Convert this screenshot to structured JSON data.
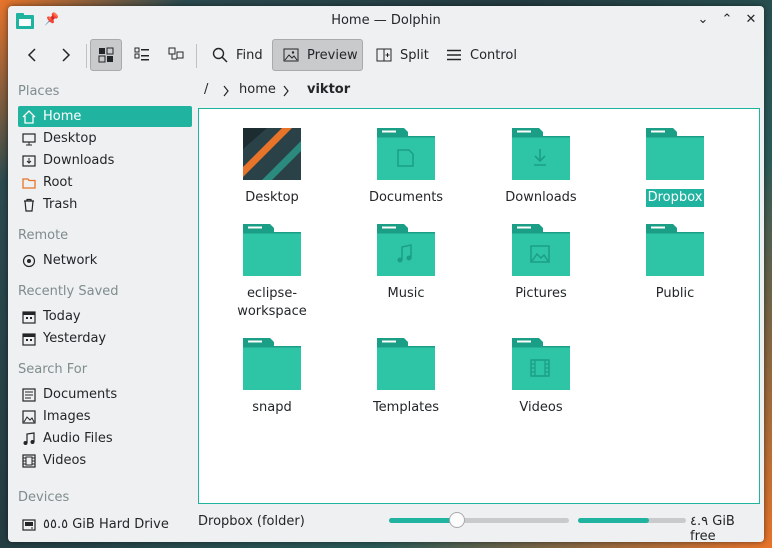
{
  "window": {
    "title": "Home — Dolphin",
    "buttons": [
      "⌄",
      "⌃",
      "✕"
    ]
  },
  "toolbar": {
    "back_icon": "chevron-left-icon",
    "forward_icon": "chevron-right-icon",
    "find_label": "Find",
    "preview_label": "Preview",
    "split_label": "Split",
    "control_label": "Control"
  },
  "sidebar": {
    "places_title": "Places",
    "places": [
      {
        "label": "Home",
        "icon": "home-icon",
        "selected": true
      },
      {
        "label": "Desktop",
        "icon": "desktop-icon"
      },
      {
        "label": "Downloads",
        "icon": "download-icon"
      },
      {
        "label": "Root",
        "icon": "folder-root-icon"
      },
      {
        "label": "Trash",
        "icon": "trash-icon"
      }
    ],
    "remote_title": "Remote",
    "remote": [
      {
        "label": "Network",
        "icon": "network-icon"
      }
    ],
    "recent_title": "Recently Saved",
    "recent": [
      {
        "label": "Today",
        "icon": "calendar-icon"
      },
      {
        "label": "Yesterday",
        "icon": "calendar-icon"
      }
    ],
    "search_title": "Search For",
    "search": [
      {
        "label": "Documents",
        "icon": "document-icon"
      },
      {
        "label": "Images",
        "icon": "image-icon"
      },
      {
        "label": "Audio Files",
        "icon": "audio-icon"
      },
      {
        "label": "Videos",
        "icon": "video-icon"
      }
    ],
    "devices_title": "Devices",
    "devices": [
      {
        "label": "٥٥.٥ GiB Hard Drive",
        "icon": "hard-drive-icon"
      }
    ]
  },
  "breadcrumb": {
    "root": "/",
    "items": [
      "home",
      "viktor"
    ]
  },
  "files": [
    {
      "name": "Desktop",
      "kind": "desktop-thumbnail"
    },
    {
      "name": "Documents",
      "kind": "document-folder-icon"
    },
    {
      "name": "Downloads",
      "kind": "download-folder-icon"
    },
    {
      "name": "Dropbox",
      "kind": "folder-icon",
      "selected": true
    },
    {
      "name": "eclipse-\nworkspace",
      "kind": "folder-icon"
    },
    {
      "name": "Music",
      "kind": "music-folder-icon"
    },
    {
      "name": "Pictures",
      "kind": "pictures-folder-icon"
    },
    {
      "name": "Public",
      "kind": "folder-icon"
    },
    {
      "name": "snapd",
      "kind": "folder-icon"
    },
    {
      "name": "Templates",
      "kind": "folder-icon"
    },
    {
      "name": "Videos",
      "kind": "videos-folder-icon"
    }
  ],
  "status": {
    "selection_text": "Dropbox (folder)",
    "zoom_fraction": 0.38,
    "space_used_fraction": 0.66,
    "free_text": "٤.٩ GiB free"
  },
  "colors": {
    "accent": "#1fb3a0",
    "folder": "#2ec4a6",
    "folder_dark": "#1b9e86"
  }
}
